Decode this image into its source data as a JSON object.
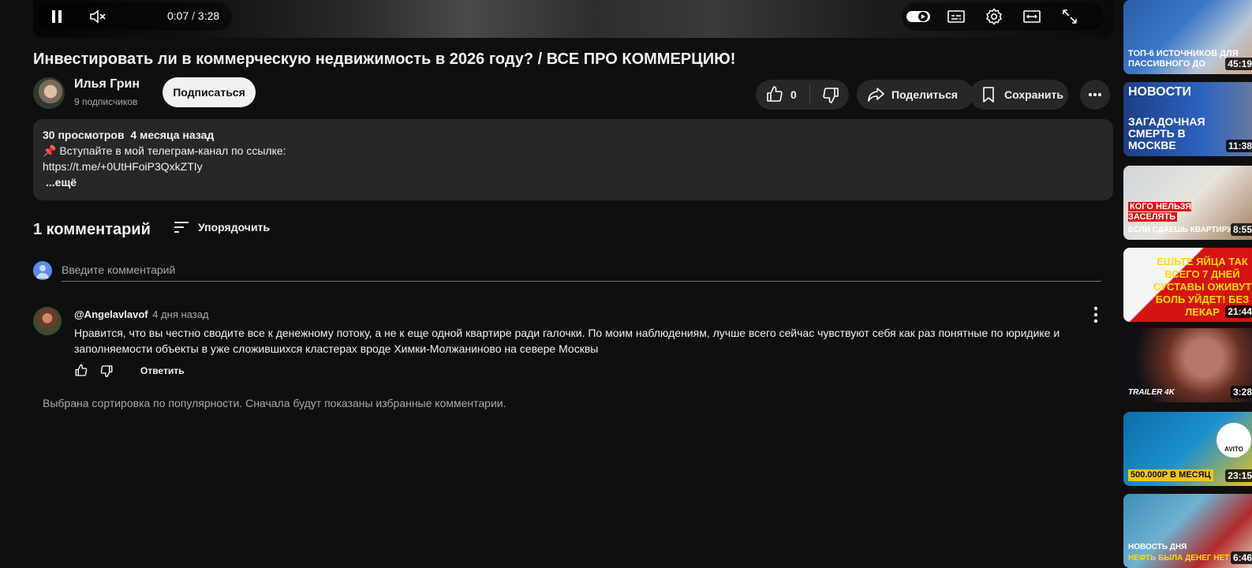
{
  "player": {
    "current_time": "0:07",
    "separator": " / ",
    "duration": "3:28"
  },
  "video": {
    "title": "Инвестировать ли в коммерческую недвижимость в 2026 году? / ВСЕ ПРО КОММЕРЦИЮ!"
  },
  "channel": {
    "name": "Илья Грин",
    "subscribers": "9 подписчиков",
    "subscribe_label": "Подписаться"
  },
  "actions": {
    "like_count": "0",
    "share_label": "Поделиться",
    "save_label": "Сохранить"
  },
  "description": {
    "views": "30 просмотров",
    "date": "4 месяца назад",
    "line1": "📌 Вступайте в мой телеграм-канал по ссылке:",
    "link": "https://t.me/+0UtHFoiP3QxkZTIy",
    "more_label": "...ещё"
  },
  "comments": {
    "count_label": "1 комментарий",
    "sort_label": "Упорядочить",
    "input_placeholder": "Введите комментарий",
    "items": [
      {
        "author": "@Angelavlavof",
        "time": "4 дня назад",
        "text": "Нравится, что вы честно сводите все к денежному потоку, а не к еще одной квартире ради галочки. По моим наблюдениям, лучше всего сейчас чувствуют себя как раз понятные по юридике и заполняемости объекты в уже сложившихся кластерах вроде Химки-Молжаниново на севере Москвы",
        "reply_label": "Ответить"
      }
    ],
    "sort_note": "Выбрана сортировка по популярности. Сначала будут показаны избранные комментарии."
  },
  "sidebar": {
    "thumbnails": [
      {
        "text": "ТОП-6 ИСТОЧНИКОВ ДЛЯ ПАССИВНОГО ДО",
        "duration": "45:19"
      },
      {
        "text_top": "НОВОСТИ",
        "text": "ЗАГАДОЧНАЯ СМЕРТЬ В МОСКВЕ",
        "duration": "11:38"
      },
      {
        "text": "КОГО НЕЛЬЗЯ ЗАСЕЛЯТЬ",
        "text2": "ЕСЛИ СДАЕШЬ КВАРТИРУ",
        "duration": "8:55"
      },
      {
        "text": "ЕШЬТЕ ЯЙЦА ТАК ВСЕГО 7 ДНЕЙ СУСТАВЫ ОЖИВУТ БОЛЬ УЙДЕТ! БЕЗ ЛЕКАР",
        "duration": "21:44"
      },
      {
        "text": "TRAILER 4K",
        "duration": "3:28"
      },
      {
        "text": "500.000Р В МЕСЯЦ",
        "badge": "AVITO",
        "duration": "23:15"
      },
      {
        "text": "НОВОСТЬ ДНЯ",
        "text2": "НЕФТЬ БЫЛА ДЕНЕГ НЕТ",
        "duration": "6:46"
      }
    ]
  },
  "colors": {
    "background": "#0f0f0f",
    "surface": "#272727",
    "text": "#f1f1f1",
    "secondary_text": "#aaaaaa"
  }
}
